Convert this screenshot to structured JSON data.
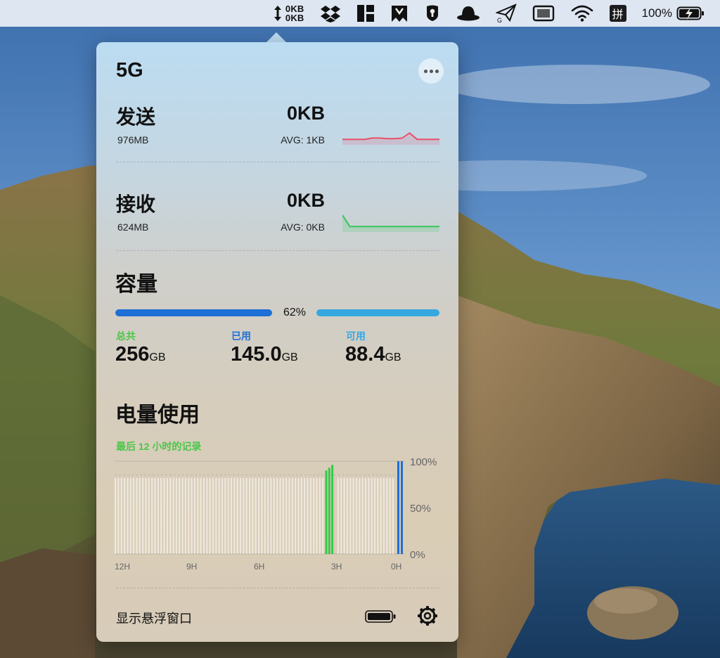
{
  "menubar": {
    "net_up": "0KB",
    "net_down": "0KB",
    "icons": [
      "dropbox-icon",
      "tiles-icon",
      "bookmark-icon",
      "keyhole-icon",
      "hat-icon",
      "paper-plane-icon",
      "screen-icon",
      "wifi-icon"
    ],
    "input_method": "拼",
    "battery_percent": "100%"
  },
  "panel": {
    "title": "5G",
    "upload": {
      "label": "发送",
      "total": "976MB",
      "rate": "0KB",
      "avg": "AVG: 1KB",
      "color": "#e8506a",
      "spark": [
        0.1,
        0.1,
        0.1,
        0.1,
        0.2,
        0.2,
        0.15,
        0.15,
        0.2,
        0.6,
        0.1,
        0.1,
        0.1,
        0.1
      ]
    },
    "download": {
      "label": "接收",
      "total": "624MB",
      "rate": "0KB",
      "avg": "AVG: 0KB",
      "color": "#34c759",
      "spark": [
        1.0,
        0.1,
        0.1,
        0.1,
        0.1,
        0.1,
        0.1,
        0.1,
        0.1,
        0.1,
        0.1,
        0.1,
        0.1,
        0.1
      ]
    },
    "capacity": {
      "title": "容量",
      "percent": 62,
      "percent_label": "62%",
      "used_color": "#1e6fd6",
      "avail_color": "#35a8e0",
      "stats": [
        {
          "label": "总共",
          "value": "256",
          "unit": "GB",
          "color": "#4cc64a"
        },
        {
          "label": "已用",
          "value": "145.0",
          "unit": "GB",
          "color": "#1e6fd6"
        },
        {
          "label": "可用",
          "value": "88.4",
          "unit": "GB",
          "color": "#35a8e0"
        }
      ]
    },
    "battery": {
      "title": "电量使用",
      "subtitle": "最后 12 小时的记录",
      "x_ticks": [
        "12H",
        "9H",
        "6H",
        "3H",
        "0H"
      ],
      "y_ticks": [
        "100%",
        "50%",
        "0%"
      ],
      "chart_data": {
        "type": "bar",
        "xlabel": "",
        "ylabel": "",
        "ylim": [
          0,
          100
        ],
        "x_range": [
          12,
          0
        ],
        "values_gray": 82,
        "values_green": [
          90,
          93,
          96
        ],
        "value_blue": 100
      }
    },
    "footer": {
      "float_label": "显示悬浮窗口"
    }
  }
}
